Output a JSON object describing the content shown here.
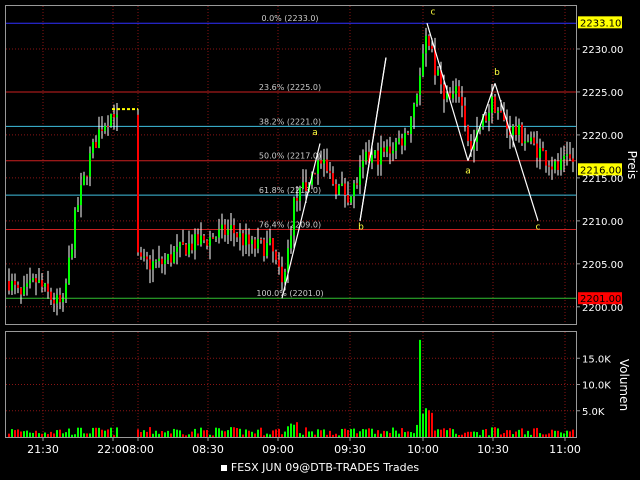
{
  "chart_data": [
    {
      "type": "candlestick",
      "panel": "price",
      "ylabel": "Preis",
      "ylim": [
        2198,
        2235
      ],
      "yticks": [
        {
          "v": 2200,
          "label": "2200.00"
        },
        {
          "v": 2205,
          "label": "2205.00"
        },
        {
          "v": 2210,
          "label": "2210.00"
        },
        {
          "v": 2215,
          "label": "2215.00"
        },
        {
          "v": 2220,
          "label": "2220.00"
        },
        {
          "v": 2225,
          "label": "2225.00"
        },
        {
          "v": 2230,
          "label": "2230.00"
        }
      ],
      "price_markers": [
        {
          "v": 2233.1,
          "label": "2233.10",
          "bg": "#ffff00"
        },
        {
          "v": 2216.0,
          "label": "2216.00",
          "bg": "#ffff00"
        },
        {
          "v": 2201.0,
          "label": "2201.00",
          "bg": "#ff0000"
        }
      ],
      "fib_levels": [
        {
          "v": 2233.0,
          "label": "0.0% (2233.0)",
          "color": "#3030ff"
        },
        {
          "v": 2225.0,
          "label": "23.6% (2225.0)",
          "color": "#cc2020"
        },
        {
          "v": 2221.0,
          "label": "38.2% (2221.0)",
          "color": "#40c0e0"
        },
        {
          "v": 2217.0,
          "label": "50.0% (2217.0)",
          "color": "#cc2020"
        },
        {
          "v": 2213.0,
          "label": "61.8% (2213.0)",
          "color": "#40c0e0"
        },
        {
          "v": 2209.0,
          "label": "76.4% (2209.0)",
          "color": "#cc2020"
        },
        {
          "v": 2201.0,
          "label": "100.0% (2201.0)",
          "color": "#30c030"
        }
      ],
      "wave_labels": [
        {
          "text": "a",
          "x": 315,
          "v": 2220.0
        },
        {
          "text": "b",
          "x": 361,
          "v": 2209.0
        },
        {
          "text": "c",
          "x": 433,
          "v": 2234.0
        },
        {
          "text": "a",
          "x": 468,
          "v": 2215.5
        },
        {
          "text": "b",
          "x": 497,
          "v": 2227.0
        },
        {
          "text": "c",
          "x": 538,
          "v": 2209.0
        }
      ],
      "colors": {
        "up": "#00ff00",
        "down": "#ff0000",
        "grid": "#8a1515",
        "wave_line": "#ffffff"
      }
    },
    {
      "type": "bar",
      "panel": "volume",
      "ylabel": "Volumen",
      "ylim": [
        0,
        20000
      ],
      "yticks": [
        {
          "v": 5000,
          "label": "5.0K"
        },
        {
          "v": 10000,
          "label": "10.0K"
        },
        {
          "v": 15000,
          "label": "15.0K"
        }
      ]
    }
  ],
  "x_axis": {
    "ticks": [
      {
        "x": 43,
        "label": "21:30"
      },
      {
        "x": 113,
        "label": "22:00"
      },
      {
        "x": 138,
        "label": "08:00"
      },
      {
        "x": 208,
        "label": "08:30"
      },
      {
        "x": 278,
        "label": "09:00"
      },
      {
        "x": 350,
        "label": "09:30"
      },
      {
        "x": 423,
        "label": "10:00"
      },
      {
        "x": 493,
        "label": "10:30"
      },
      {
        "x": 565,
        "label": "11:00"
      }
    ]
  },
  "legend": {
    "text": "FESX JUN 09@DTB-TRADES Trades"
  }
}
